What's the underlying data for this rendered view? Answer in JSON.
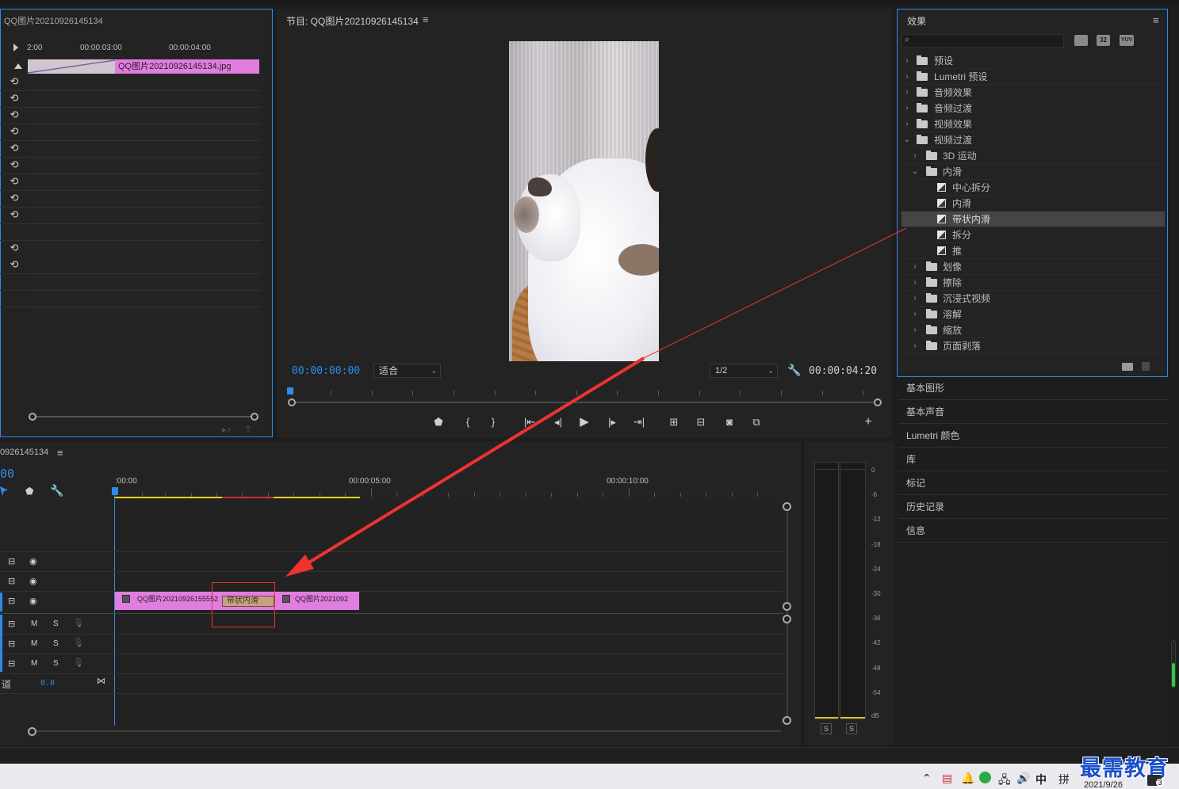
{
  "source_panel": {
    "title": "QQ图片20210926145134",
    "ruler": [
      "2:00",
      "00:00:03:00",
      "00:00:04:00"
    ],
    "clip_label": "QQ图片20210926145134.jpg"
  },
  "program_monitor": {
    "title": "节目: QQ图片20210926145134",
    "menu_icon": "≡",
    "timecode_current": "00:00:00:00",
    "fit_select": "适合",
    "resolution_select": "1/2",
    "timecode_duration": "00:00:04:20",
    "add_icon": "+"
  },
  "effects_panel": {
    "title": "效果",
    "menu_icon": "≡",
    "search_placeholder": "",
    "filter_buttons": [
      "32",
      "YUV"
    ],
    "tree": [
      {
        "label": "预设",
        "kind": "folder-star",
        "level": 0,
        "open": false
      },
      {
        "label": "Lumetri 预设",
        "kind": "folder-star",
        "level": 0,
        "open": false
      },
      {
        "label": "音频效果",
        "kind": "folder",
        "level": 0,
        "open": false
      },
      {
        "label": "音频过渡",
        "kind": "folder",
        "level": 0,
        "open": false
      },
      {
        "label": "视频效果",
        "kind": "folder",
        "level": 0,
        "open": false
      },
      {
        "label": "视频过渡",
        "kind": "folder",
        "level": 0,
        "open": true
      },
      {
        "label": "3D 运动",
        "kind": "folder",
        "level": 1,
        "open": false
      },
      {
        "label": "内滑",
        "kind": "folder",
        "level": 1,
        "open": true
      },
      {
        "label": "中心拆分",
        "kind": "transition",
        "level": 2
      },
      {
        "label": "内滑",
        "kind": "transition",
        "level": 2
      },
      {
        "label": "带状内滑",
        "kind": "transition",
        "level": 2,
        "selected": true
      },
      {
        "label": "拆分",
        "kind": "transition",
        "level": 2
      },
      {
        "label": "推",
        "kind": "transition",
        "level": 2
      },
      {
        "label": "划像",
        "kind": "folder",
        "level": 1,
        "open": false
      },
      {
        "label": "擦除",
        "kind": "folder",
        "level": 1,
        "open": false
      },
      {
        "label": "沉浸式视频",
        "kind": "folder",
        "level": 1,
        "open": false
      },
      {
        "label": "溶解",
        "kind": "folder",
        "level": 1,
        "open": false
      },
      {
        "label": "缩放",
        "kind": "folder",
        "level": 1,
        "open": false
      },
      {
        "label": "页面剥落",
        "kind": "folder",
        "level": 1,
        "open": false
      }
    ]
  },
  "side_panels": [
    "基本图形",
    "基本声音",
    "Lumetri 颜色",
    "库",
    "标记",
    "历史记录",
    "信息"
  ],
  "timeline": {
    "title": "0926145134",
    "menu_icon": "≡",
    "timecode": "00",
    "ruler": [
      ":00:00",
      "00:00:05:00",
      "00:00:10:00"
    ],
    "clip1_label": "QQ图片20210926155552",
    "clip2_label": "QQ图片2021092",
    "transition_label": "带状内滑",
    "track_row_label": "道",
    "track_value": "0.0",
    "audio_track_buttons": [
      "M",
      "S"
    ]
  },
  "audio_meter": {
    "scale": [
      "0",
      "-6",
      "-12",
      "-18",
      "-24",
      "-30",
      "-36",
      "-42",
      "-48",
      "-54",
      "dB"
    ],
    "solo_buttons": [
      "S",
      "S"
    ]
  },
  "taskbar": {
    "ime_label": "中",
    "date": "2021/9/26",
    "watermark": "最需教育",
    "notification_count": "3"
  },
  "colors": {
    "accent_blue": "#2d8ceb",
    "clip_pink": "#e27de0",
    "annotation_red": "#ee3232",
    "transition_tan": "#c8a07e"
  }
}
